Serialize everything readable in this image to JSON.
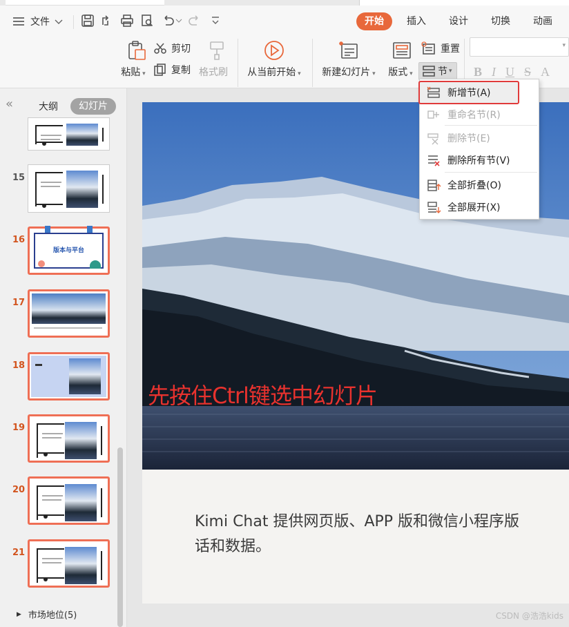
{
  "menubar": {
    "file_label": "文件"
  },
  "tabs": [
    "开始",
    "插入",
    "设计",
    "切换",
    "动画"
  ],
  "ribbon": {
    "paste": "粘贴",
    "cut": "剪切",
    "copy": "复制",
    "format_painter": "格式刷",
    "from_current": "从当前开始",
    "new_slide": "新建幻灯片",
    "layout": "版式",
    "reset": "重置",
    "section": "节",
    "font_b": "B",
    "font_i": "I",
    "font_u": "U",
    "font_s": "S",
    "font_a": "A"
  },
  "panel": {
    "collapse": "«",
    "tab_outline": "大纲",
    "tab_slides": "幻灯片",
    "section_label": "市场地位(5)",
    "slides": [
      {
        "num": "",
        "selected": false
      },
      {
        "num": "15",
        "selected": false
      },
      {
        "num": "16",
        "selected": true,
        "title": "版本与平台"
      },
      {
        "num": "17",
        "selected": true
      },
      {
        "num": "18",
        "selected": true
      },
      {
        "num": "19",
        "selected": true
      },
      {
        "num": "20",
        "selected": true
      },
      {
        "num": "21",
        "selected": true
      }
    ]
  },
  "slide": {
    "overlay_text": "先按住Ctrl键选中幻灯片",
    "body_line1": "Kimi Chat 提供网页版、APP 版和微信小程序版",
    "body_line2": "话和数据。"
  },
  "section_menu": {
    "items": [
      {
        "label": "新增节(A)",
        "enabled": true,
        "highlight": true
      },
      {
        "label": "重命名节(R)",
        "enabled": false
      },
      {
        "label": "删除节(E)",
        "enabled": false
      },
      {
        "label": "删除所有节(V)",
        "enabled": true
      },
      {
        "label": "全部折叠(O)",
        "enabled": true
      },
      {
        "label": "全部展开(X)",
        "enabled": true
      }
    ]
  },
  "watermark": "CSDN @浩浩kids",
  "colors": {
    "accent": "#e8683b",
    "selection": "#ef6f55",
    "highlight_box": "#e03a3a",
    "overlay_text": "#e8322e"
  }
}
